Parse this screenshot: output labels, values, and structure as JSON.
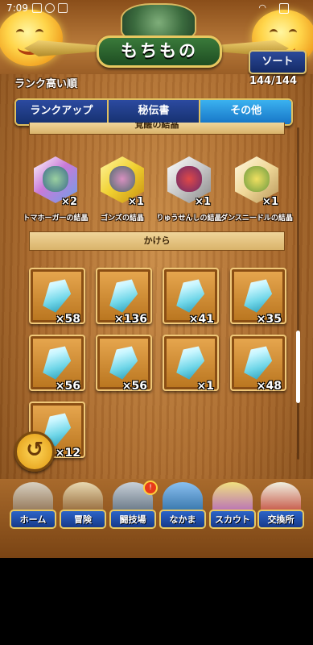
{
  "status": {
    "time": "7:09"
  },
  "header": {
    "title": "もちもの",
    "sort_button": "ソート"
  },
  "sort_label": "ランク高い順",
  "count": "144/144",
  "tabs": [
    {
      "label": "ランクアップ",
      "active": false
    },
    {
      "label": "秘伝書",
      "active": false
    },
    {
      "label": "その他",
      "active": true
    }
  ],
  "sections": {
    "orbs_title": "覚醒の結晶",
    "shards_title": "かけら"
  },
  "orbs": [
    {
      "name": "トマホーガーの結晶",
      "qty": "×2",
      "color": "#c97ad8"
    },
    {
      "name": "ゴンズの結晶",
      "qty": "×1",
      "color": "#f0d030"
    },
    {
      "name": "りゅうせんしの結晶",
      "qty": "×1",
      "color": "#d0d0d0"
    },
    {
      "name": "ダンスニードルの結晶",
      "qty": "×1",
      "color": "#f0d898"
    }
  ],
  "shards": [
    {
      "qty": "×58"
    },
    {
      "qty": "×136"
    },
    {
      "qty": "×41"
    },
    {
      "qty": "×35"
    },
    {
      "qty": "×56"
    },
    {
      "qty": "×56"
    },
    {
      "qty": "×1"
    },
    {
      "qty": "×48"
    },
    {
      "qty": "×12"
    }
  ],
  "nav": [
    {
      "label": "ホーム",
      "icon": "home-icon"
    },
    {
      "label": "冒険",
      "icon": "adventure-icon"
    },
    {
      "label": "闘技場",
      "icon": "arena-icon",
      "badge": "!"
    },
    {
      "label": "なかま",
      "icon": "party-icon"
    },
    {
      "label": "スカウト",
      "icon": "scout-icon"
    },
    {
      "label": "交換所",
      "icon": "exchange-icon"
    }
  ]
}
